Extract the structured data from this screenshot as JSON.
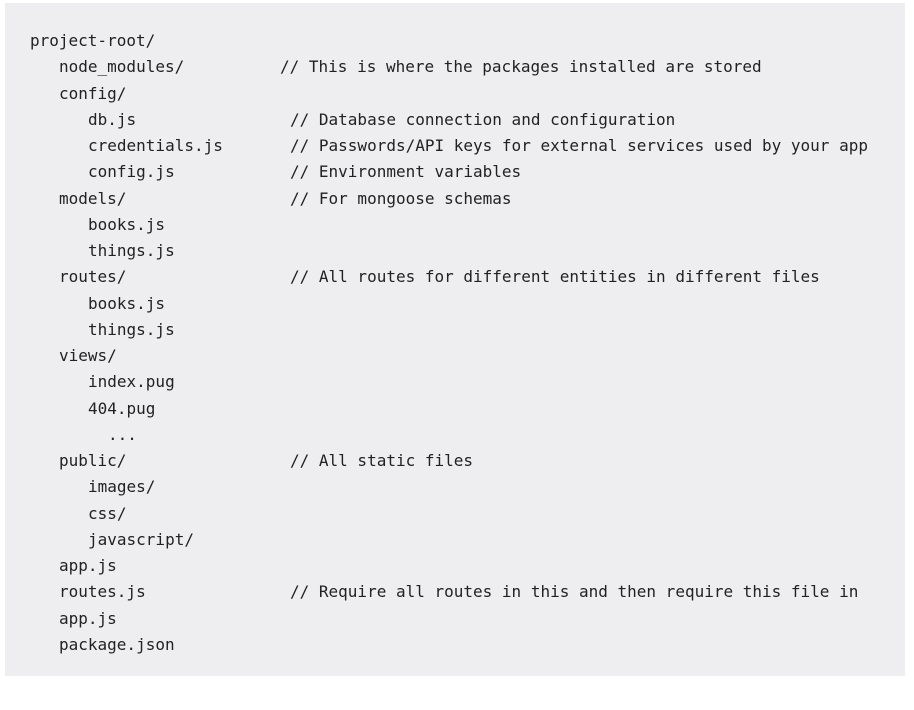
{
  "lines": [
    {
      "text": "project-root/",
      "comment": ""
    },
    {
      "text": "node_modules/",
      "comment": "// This is where the packages installed are stored"
    },
    {
      "text": "config/",
      "comment": ""
    },
    {
      "text": "db.js",
      "comment": "// Database connection and configuration"
    },
    {
      "text": "credentials.js",
      "comment": "// Passwords/API keys for external services used by your app"
    },
    {
      "text": "config.js",
      "comment": "// Environment variables"
    },
    {
      "text": "models/",
      "comment": "// For mongoose schemas"
    },
    {
      "text": "books.js",
      "comment": ""
    },
    {
      "text": "things.js",
      "comment": ""
    },
    {
      "text": "routes/",
      "comment": "// All routes for different entities in different files"
    },
    {
      "text": "books.js",
      "comment": ""
    },
    {
      "text": "things.js",
      "comment": ""
    },
    {
      "text": "views/",
      "comment": ""
    },
    {
      "text": "index.pug",
      "comment": ""
    },
    {
      "text": "404.pug",
      "comment": ""
    },
    {
      "text": "...",
      "comment": ""
    },
    {
      "text": "public/",
      "comment": "// All static files"
    },
    {
      "text": "images/",
      "comment": ""
    },
    {
      "text": "css/",
      "comment": ""
    },
    {
      "text": "javascript/",
      "comment": ""
    },
    {
      "text": "app.js",
      "comment": ""
    },
    {
      "text": "routes.js",
      "comment": "// Require all routes in this and then require this file in"
    },
    {
      "text": "app.js",
      "comment": ""
    },
    {
      "text": "package.json",
      "comment": ""
    }
  ]
}
